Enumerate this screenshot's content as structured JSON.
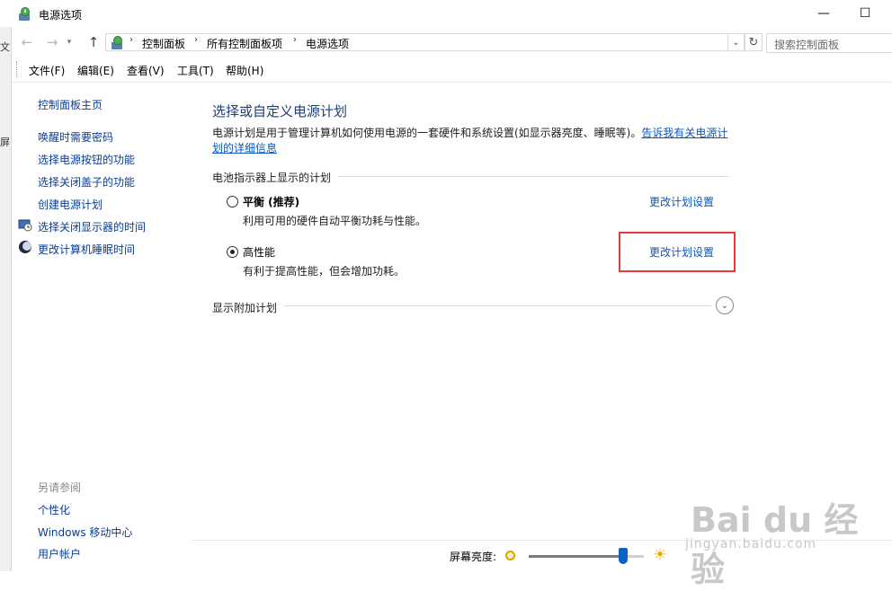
{
  "window": {
    "title": "电源选项",
    "minimize_glyph": "—",
    "maximize_glyph": "☐"
  },
  "background_strip": {
    "fragments": [
      "文",
      "屏"
    ]
  },
  "address": {
    "crumbs": [
      "控制面板",
      "所有控制面板项",
      "电源选项"
    ],
    "separator": "›",
    "search_placeholder": "搜索控制面板"
  },
  "menu": {
    "items": [
      "文件(F)",
      "编辑(E)",
      "查看(V)",
      "工具(T)",
      "帮助(H)"
    ]
  },
  "sidebar": {
    "home": "控制面板主页",
    "links": [
      "唤醒时需要密码",
      "选择电源按钮的功能",
      "选择关闭盖子的功能",
      "创建电源计划"
    ],
    "icon_links": [
      "选择关闭显示器的时间",
      "更改计算机睡眠时间"
    ],
    "see_also_title": "另请参阅",
    "see_also": [
      "个性化",
      "Windows 移动中心",
      "用户帐户"
    ]
  },
  "main": {
    "title": "选择或自定义电源计划",
    "description": "电源计划是用于管理计算机如何使用电源的一套硬件和系统设置(如显示器亮度、睡眠等)。",
    "description_link": "告诉我有关电源计划的详细信息",
    "group_header": "电池指示器上显示的计划",
    "plans": [
      {
        "name": "平衡 (推荐)",
        "desc": "利用可用的硬件自动平衡功耗与性能。",
        "link": "更改计划设置",
        "selected": false
      },
      {
        "name": "高性能",
        "desc": "有利于提高性能，但会增加功耗。",
        "link": "更改计划设置",
        "selected": true
      }
    ],
    "more_plans": "显示附加计划"
  },
  "bottom": {
    "brightness_label": "屏幕亮度:",
    "brightness_level": 0.82
  },
  "watermark": {
    "line1": "Bai du 经验",
    "line2": "jingyan.baidu.com"
  },
  "colors": {
    "link": "#0b56b8",
    "title": "#1e3d7b",
    "highlight": "#e53935",
    "slider_thumb": "#0a64c8"
  }
}
